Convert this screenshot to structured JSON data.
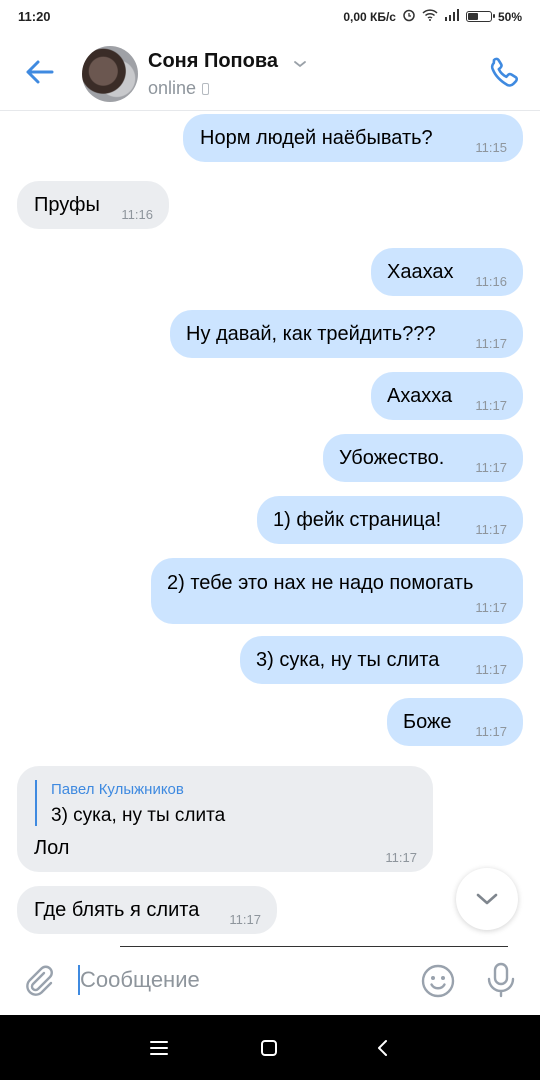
{
  "status_bar": {
    "time": "11:20",
    "network_speed": "0,00 КБ/с",
    "battery_percent": "50%",
    "battery_level": 0.5,
    "icons": [
      "alarm-icon",
      "wifi-icon",
      "signal-icon",
      "battery-icon"
    ]
  },
  "header": {
    "contact_name": "Соня Попова",
    "status": "online"
  },
  "messages": [
    {
      "side": "out",
      "text": "Норм людей наёбывать?",
      "time": "11:15"
    },
    {
      "side": "in",
      "text": "Пруфы",
      "time": "11:16"
    },
    {
      "side": "out",
      "text": "Хаахах",
      "time": "11:16"
    },
    {
      "side": "out",
      "text": "Ну давай, как трейдить???",
      "time": "11:17"
    },
    {
      "side": "out",
      "text": "Ахахха",
      "time": "11:17"
    },
    {
      "side": "out",
      "text": "Убожество.",
      "time": "11:17"
    },
    {
      "side": "out",
      "text": "1) фейк страница!",
      "time": "11:17"
    },
    {
      "side": "out",
      "text": "2) тебе это нах не надо помогать",
      "time": "11:17"
    },
    {
      "side": "out",
      "text": "3) сука, ну ты слита",
      "time": "11:17"
    },
    {
      "side": "out",
      "text": "Боже",
      "time": "11:17"
    },
    {
      "side": "in",
      "text": "Лол",
      "time": "11:17",
      "reply": {
        "author": "Павел Кулыжников",
        "text": "3) сука, ну ты слита"
      }
    },
    {
      "side": "in",
      "text": "Где блять я слита",
      "time": "11:17"
    }
  ],
  "composer": {
    "placeholder": "Сообщение",
    "value": ""
  },
  "colors": {
    "accent": "#3f8ae0",
    "outgoing_bubble": "#cce4ff",
    "incoming_bubble": "#ebedf0",
    "secondary_text": "#8e959c"
  }
}
